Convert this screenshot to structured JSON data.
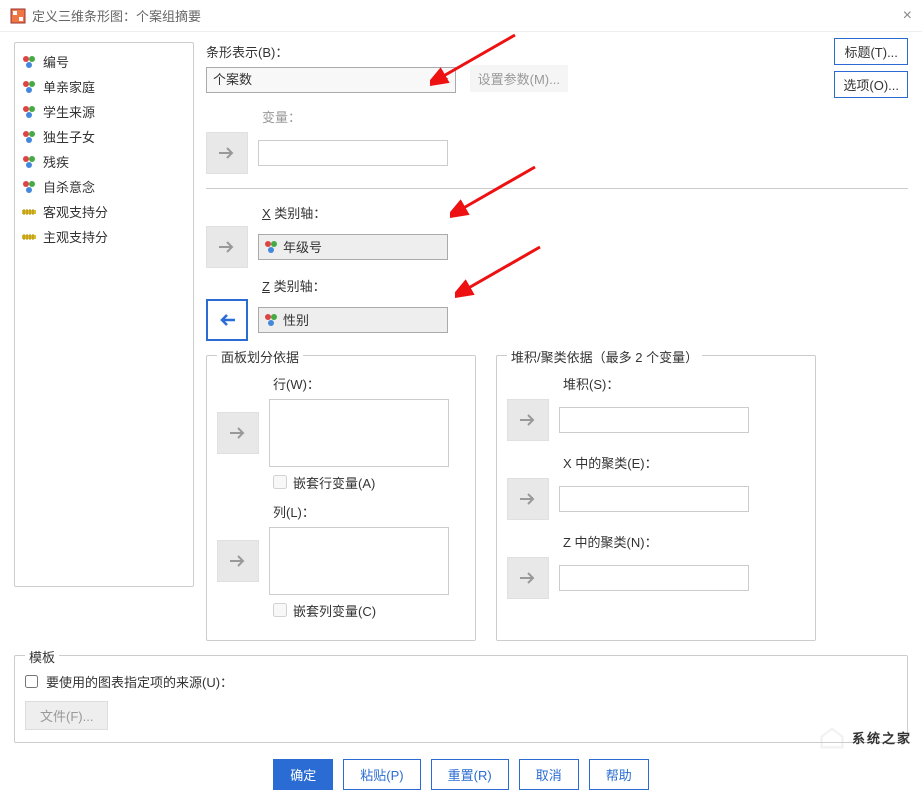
{
  "window": {
    "title": "定义三维条形图：个案组摘要"
  },
  "topButtons": {
    "title": "标题(T)...",
    "options": "选项(O)..."
  },
  "varlist": {
    "items": [
      {
        "label": "编号",
        "type": "nom"
      },
      {
        "label": "单亲家庭",
        "type": "nom"
      },
      {
        "label": "学生来源",
        "type": "nom"
      },
      {
        "label": "独生子女",
        "type": "nom"
      },
      {
        "label": "残疾",
        "type": "nom"
      },
      {
        "label": "自杀意念",
        "type": "nom"
      },
      {
        "label": "客观支持分",
        "type": "scale"
      },
      {
        "label": "主观支持分",
        "type": "scale"
      }
    ]
  },
  "barsRepresent": {
    "label": "条形表示(B)：",
    "value": "个案数",
    "setParams": "设置参数(M)..."
  },
  "variable": {
    "label": "变量：",
    "value": ""
  },
  "xAxis": {
    "label": "X 类别轴：",
    "value": "年级号"
  },
  "zAxis": {
    "label": "Z 类别轴：",
    "value": "性别"
  },
  "panelBy": {
    "title": "面板划分依据",
    "rows": {
      "label": "行(W)：",
      "nest": "嵌套行变量(A)"
    },
    "cols": {
      "label": "列(L)：",
      "nest": "嵌套列变量(C)"
    }
  },
  "stackCluster": {
    "title": "堆积/聚类依据（最多 2 个变量）",
    "stack": "堆积(S)：",
    "clusterX": "X 中的聚类(E)：",
    "clusterZ": "Z 中的聚类(N)："
  },
  "template": {
    "title": "模板",
    "check": "要使用的图表指定项的来源(U)：",
    "file": "文件(F)..."
  },
  "buttons": {
    "ok": "确定",
    "paste": "粘贴(P)",
    "reset": "重置(R)",
    "cancel": "取消",
    "help": "帮助"
  },
  "watermark": "系统之家"
}
